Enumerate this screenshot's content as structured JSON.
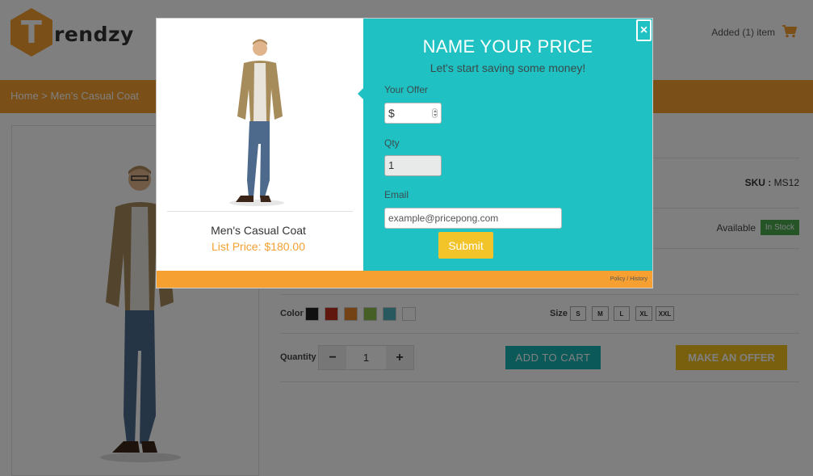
{
  "header": {
    "logo_letter": "T",
    "logo_text": "rendzy",
    "cart_status": "Added (1) item"
  },
  "breadcrumb": "Home > Men's Casual Coat",
  "product": {
    "sku_label": "SKU :",
    "sku": "MS12",
    "availability_label": "Available",
    "stock_badge": "In Stock",
    "color_label": "Color",
    "colors": [
      "#222222",
      "#c0311c",
      "#e8862a",
      "#8dbf4a",
      "#4fb3bf",
      "#ffffff"
    ],
    "size_label": "Size",
    "sizes": [
      "S",
      "M",
      "L",
      "XL",
      "XXL"
    ],
    "quantity_label": "Quantity",
    "quantity": "1",
    "qty_minus": "−",
    "qty_plus": "+",
    "add_to_cart": "ADD TO CART",
    "make_offer": "MAKE AN OFFER"
  },
  "modal": {
    "title": "NAME YOUR PRICE",
    "subtitle": "Let's start saving some money!",
    "product_name": "Men's Casual Coat",
    "list_price": "List Price: $180.00",
    "offer_label": "Your Offer",
    "offer_value": "$",
    "qty_label": "Qty",
    "qty_value": "1",
    "email_label": "Email",
    "email_placeholder": "example@pricepong.com",
    "submit": "Submit",
    "close": "×",
    "footer_link": "Policy / History"
  },
  "colors": {
    "brand_orange": "#f5a031",
    "teal": "#1fc1c3",
    "yellow": "#f3c429",
    "instock_green": "#4aa84e"
  }
}
